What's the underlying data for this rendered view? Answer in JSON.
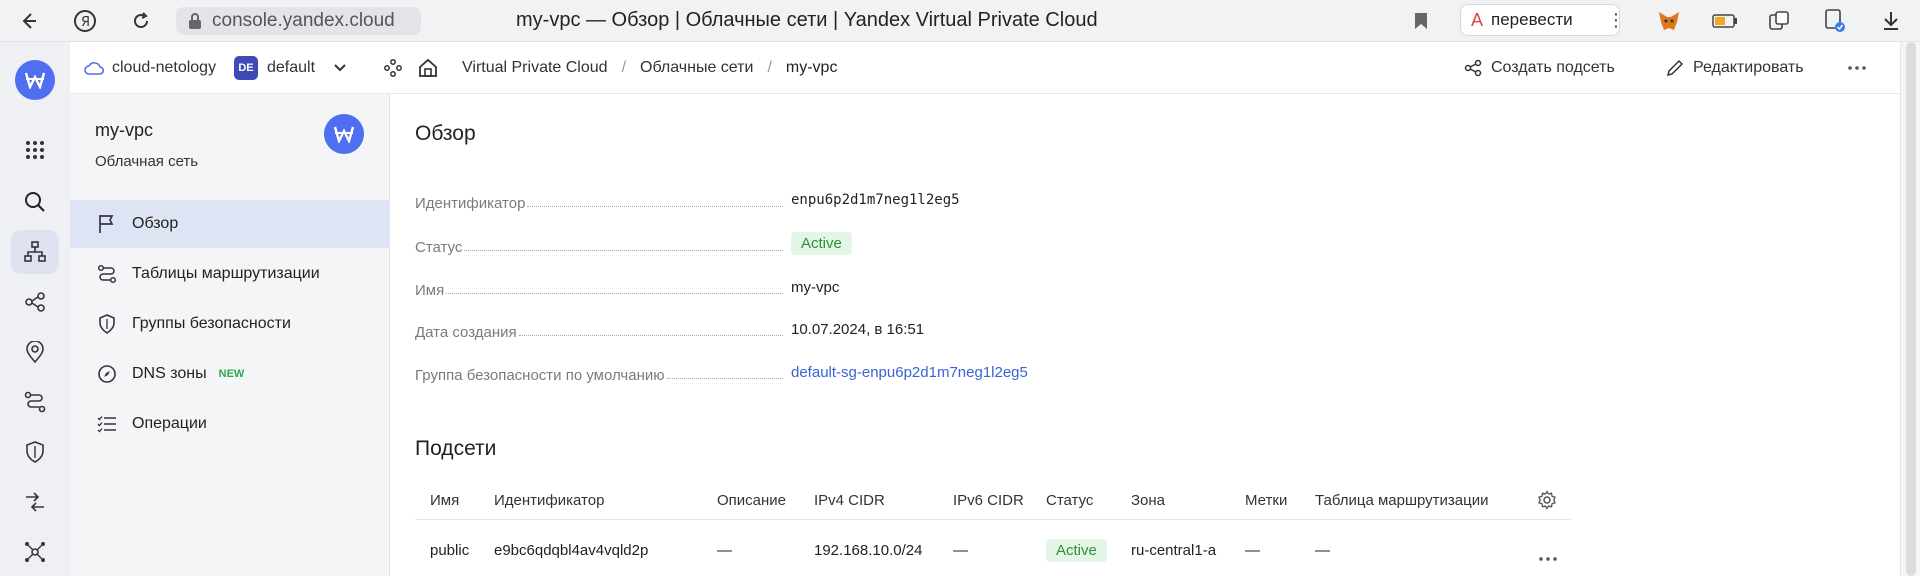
{
  "browser": {
    "url": "console.yandex.cloud",
    "tab_title": "my-vpc — Обзор | Облачные сети | Yandex Virtual Private Cloud",
    "translate_label": "перевести"
  },
  "topbar": {
    "cloud_name": "cloud-netology",
    "folder_badge": "DE",
    "folder_name": "default",
    "breadcrumbs": [
      "Virtual Private Cloud",
      "Облачные сети",
      "my-vpc"
    ],
    "create_subnet_label": "Создать подсеть",
    "edit_label": "Редактировать"
  },
  "sidebar": {
    "resource_name": "my-vpc",
    "resource_type": "Облачная сеть",
    "items": [
      {
        "label": "Обзор",
        "icon": "flag-icon"
      },
      {
        "label": "Таблицы маршрутизации",
        "icon": "route-icon"
      },
      {
        "label": "Группы безопасности",
        "icon": "shield-icon"
      },
      {
        "label": "DNS зоны",
        "icon": "compass-icon",
        "badge": "NEW"
      },
      {
        "label": "Операции",
        "icon": "list-icon"
      }
    ]
  },
  "overview": {
    "title": "Обзор",
    "fields": [
      {
        "key": "Идентификатор",
        "value": "enpu6p2d1m7neg1l2eg5"
      },
      {
        "key": "Статус",
        "value": "Active"
      },
      {
        "key": "Имя",
        "value": "my-vpc"
      },
      {
        "key": "Дата создания",
        "value": "10.07.2024, в 16:51"
      },
      {
        "key": "Группа безопасности по умолчанию",
        "value": "default-sg-enpu6p2d1m7neg1l2eg5"
      }
    ]
  },
  "subnets": {
    "title": "Подсети",
    "columns": [
      "Имя",
      "Идентификатор",
      "Описание",
      "IPv4 CIDR",
      "IPv6 CIDR",
      "Статус",
      "Зона",
      "Метки",
      "Таблица маршрутизации"
    ],
    "rows": [
      {
        "name": "public",
        "id": "e9bc6qdqbl4av4vqld2p",
        "description": "—",
        "ipv4": "192.168.10.0/24",
        "ipv6": "—",
        "status": "Active",
        "zone": "ru-central1-a",
        "labels": "—",
        "route_table": "—"
      }
    ]
  },
  "colors": {
    "accent": "#4f6ff0",
    "status_green": "#2f8f3c",
    "link": "#3a63d6"
  }
}
